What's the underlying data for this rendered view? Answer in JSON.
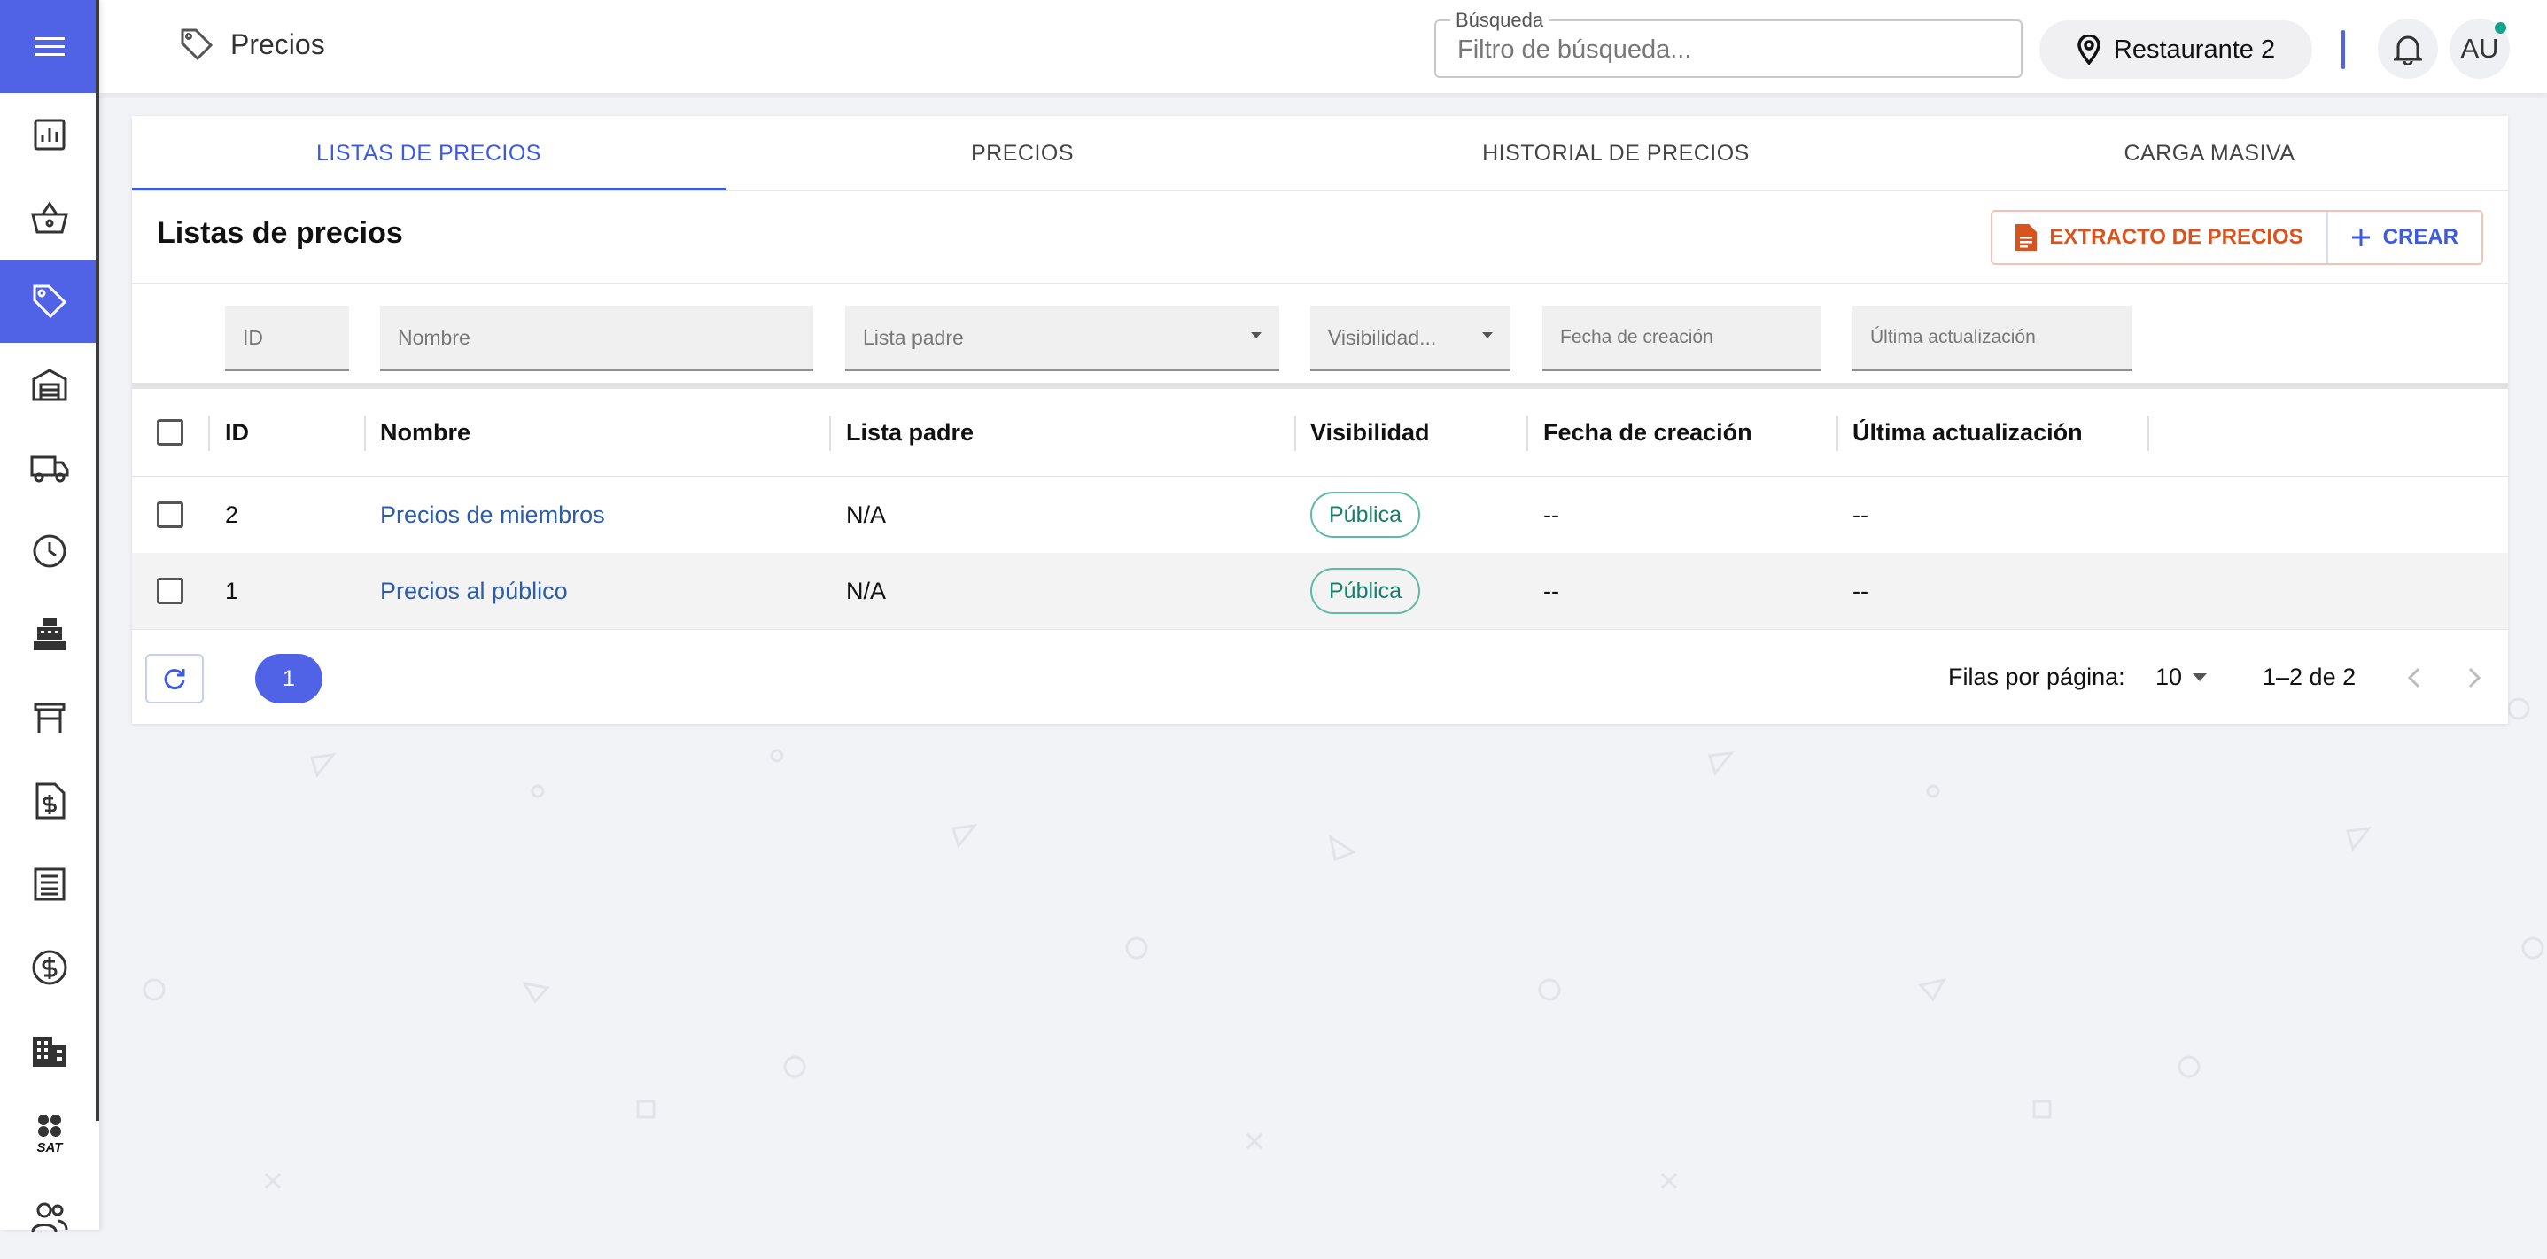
{
  "sidebar": {
    "menu_icon": "hamburger-menu-icon",
    "items": [
      {
        "icon": "bar-chart-icon",
        "active": false
      },
      {
        "icon": "basket-icon",
        "active": false
      },
      {
        "icon": "price-tag-icon",
        "active": true
      },
      {
        "icon": "warehouse-icon",
        "active": false
      },
      {
        "icon": "truck-icon",
        "active": false
      },
      {
        "icon": "clock-icon",
        "active": false
      },
      {
        "icon": "cash-register-icon",
        "active": false
      },
      {
        "icon": "table-icon",
        "active": false
      },
      {
        "icon": "invoice-dollar-icon",
        "active": false
      },
      {
        "icon": "receipt-list-icon",
        "active": false
      },
      {
        "icon": "dollar-circle-icon",
        "active": false
      },
      {
        "icon": "building-icon",
        "active": false
      },
      {
        "icon": "sat-logo-icon",
        "active": false,
        "text": "SAT"
      },
      {
        "icon": "users-icon",
        "active": false
      }
    ],
    "accent": "#5063e6"
  },
  "header": {
    "title": "Precios",
    "search": {
      "label": "Búsqueda",
      "placeholder": "Filtro de búsqueda..."
    },
    "location": "Restaurante 2",
    "avatar_initials": "AU"
  },
  "tabs": [
    {
      "label": "LISTAS DE PRECIOS",
      "active": true
    },
    {
      "label": "PRECIOS",
      "active": false
    },
    {
      "label": "HISTORIAL DE PRECIOS",
      "active": false
    },
    {
      "label": "CARGA MASIVA",
      "active": false
    }
  ],
  "section": {
    "title": "Listas de precios",
    "extract_label": "EXTRACTO DE PRECIOS",
    "create_label": "CREAR"
  },
  "filters": {
    "id": "ID",
    "nombre": "Nombre",
    "lista_padre": "Lista padre",
    "visibilidad": "Visibilidad...",
    "fecha_creacion": "Fecha de creación",
    "ultima_actualizacion": "Última actualización"
  },
  "table": {
    "columns": [
      "ID",
      "Nombre",
      "Lista padre",
      "Visibilidad",
      "Fecha de creación",
      "Última actualización"
    ],
    "rows": [
      {
        "id": "2",
        "nombre": "Precios de miembros",
        "lista_padre": "N/A",
        "visibilidad": "Pública",
        "fecha_creacion": "--",
        "ultima_actualizacion": "--"
      },
      {
        "id": "1",
        "nombre": "Precios al público",
        "lista_padre": "N/A",
        "visibilidad": "Pública",
        "fecha_creacion": "--",
        "ultima_actualizacion": "--"
      }
    ]
  },
  "pagination": {
    "current_page": "1",
    "rows_per_page_label": "Filas por página:",
    "rows_per_page": "10",
    "range": "1–2 de 2"
  },
  "colors": {
    "primary": "#3e5ae0",
    "extract": "#d9531e",
    "badge": "#17806a"
  }
}
